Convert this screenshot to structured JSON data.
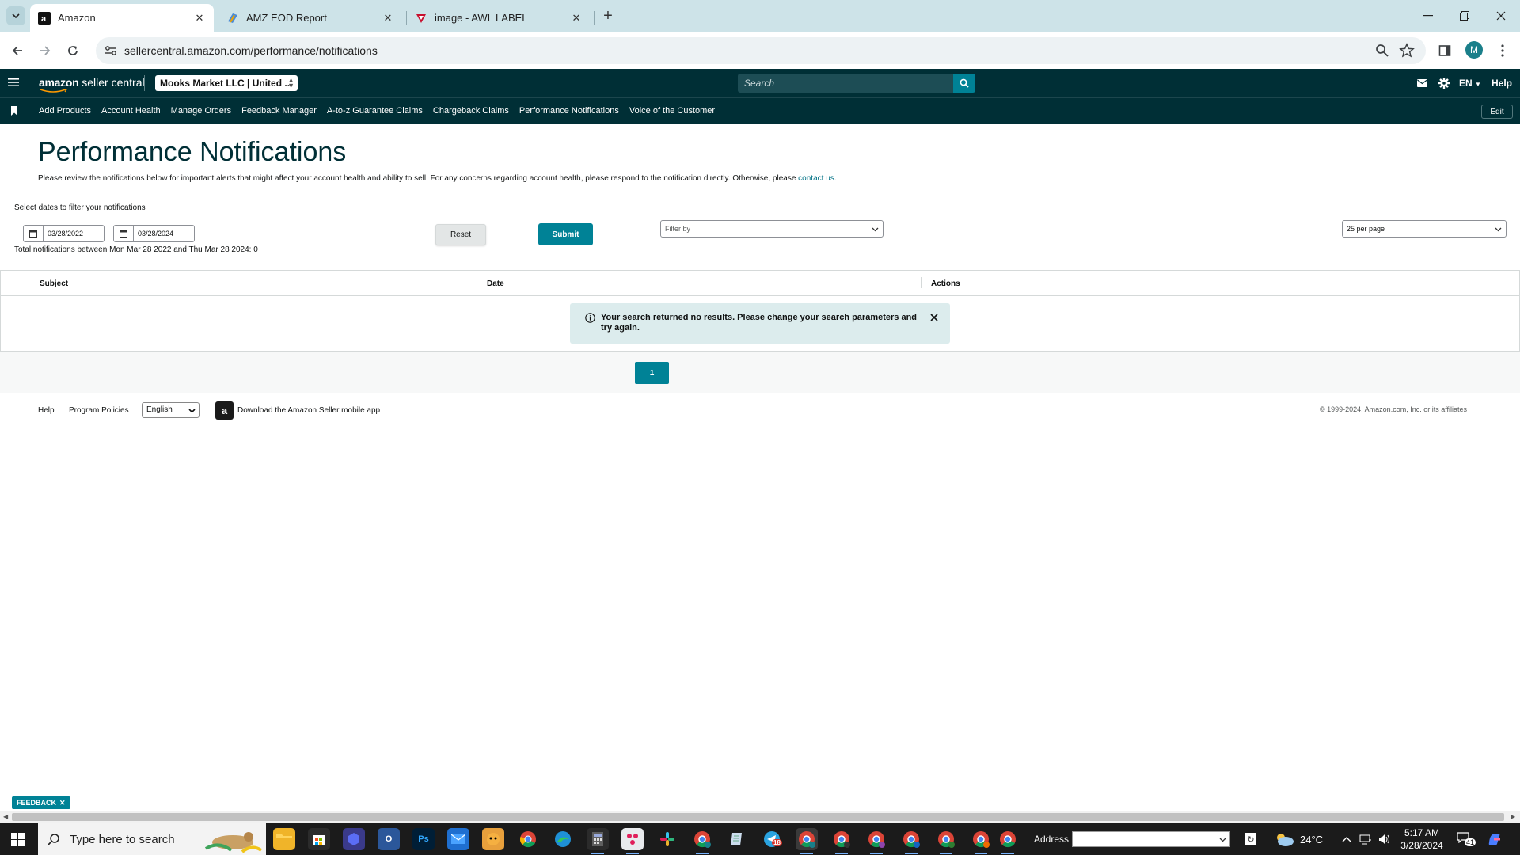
{
  "browser": {
    "tabs": [
      {
        "title": "Amazon",
        "active": true
      },
      {
        "title": "AMZ EOD Report",
        "active": false
      },
      {
        "title": "image - AWL LABEL",
        "active": false
      }
    ],
    "url": "sellercentral.amazon.com/performance/notifications",
    "profile_initial": "M"
  },
  "header": {
    "logo_brand": "amazon",
    "logo_suffix": "seller central",
    "account": "Mooks Market LLC | United ...",
    "search_placeholder": "Search",
    "language": "EN",
    "help": "Help"
  },
  "nav": {
    "links": [
      "Add Products",
      "Account Health",
      "Manage Orders",
      "Feedback Manager",
      "A-to-z Guarantee Claims",
      "Chargeback Claims",
      "Performance Notifications",
      "Voice of the Customer"
    ],
    "edit": "Edit"
  },
  "main": {
    "title": "Performance Notifications",
    "intro": "Please review the notifications below for important alerts that might affect your account health and ability to sell. For any concerns regarding account health, please respond to the notification directly. Otherwise, please",
    "intro_link": "contact us",
    "filter_caption": "Select dates to filter your notifications",
    "date_from": "03/28/2022",
    "date_to": "03/28/2024",
    "total_text": "Total notifications between Mon Mar 28 2022 and Thu Mar 28 2024: 0",
    "reset": "Reset",
    "submit": "Submit",
    "filter_by": "Filter by",
    "per_page": "25 per page",
    "columns": [
      "Subject",
      "Date",
      "Actions"
    ],
    "empty_message": "Your search returned no results. Please change your search parameters and try again.",
    "page": "1"
  },
  "footer": {
    "help": "Help",
    "program_policies": "Program Policies",
    "language": "English",
    "app_text": "Download the Amazon Seller mobile app",
    "copyright": "© 1999-2024, Amazon.com, Inc. or its affiliates"
  },
  "feedback": "FEEDBACK",
  "taskbar": {
    "search_placeholder": "Type here to search",
    "address_label": "Address",
    "temperature": "24°C",
    "time": "5:17 AM",
    "date": "3/28/2024",
    "notifications": "41",
    "mail_badge": "18"
  }
}
